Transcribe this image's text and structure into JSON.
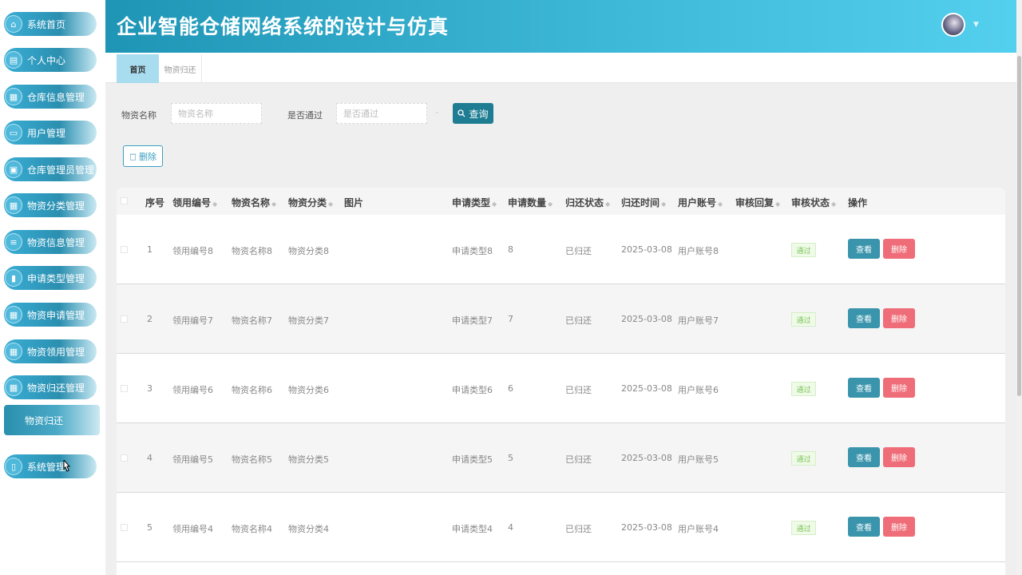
{
  "app": {
    "title": "企业智能仓储网络系统的设计与仿真"
  },
  "sidebar": {
    "items": [
      {
        "label": "系统首页",
        "icon": "home-icon"
      },
      {
        "label": "个人中心",
        "icon": "id-card-icon"
      },
      {
        "label": "仓库信息管理",
        "icon": "chart-icon"
      },
      {
        "label": "用户管理",
        "icon": "monitor-icon"
      },
      {
        "label": "仓库管理员管理",
        "icon": "briefcase-icon"
      },
      {
        "label": "物资分类管理",
        "icon": "grid-icon"
      },
      {
        "label": "物资信息管理",
        "icon": "sliders-icon"
      },
      {
        "label": "申请类型管理",
        "icon": "bar-chart-icon"
      },
      {
        "label": "物资申请管理",
        "icon": "grid-icon"
      },
      {
        "label": "物资领用管理",
        "icon": "grid-icon"
      },
      {
        "label": "物资归还管理",
        "icon": "grid-icon"
      },
      {
        "label": "系统管理",
        "icon": "book-icon"
      }
    ],
    "sub_item": "物资归还"
  },
  "tabs": [
    {
      "label": "首页",
      "active": true
    },
    {
      "label": "物资归还",
      "active": false
    }
  ],
  "search": {
    "name_label": "物资名称",
    "name_placeholder": "物资名称",
    "pass_label": "是否通过",
    "pass_placeholder": "是否通过",
    "search_button": "查询",
    "delete_button": "删除"
  },
  "table": {
    "headers": [
      "序号",
      "领用编号",
      "物资名称",
      "物资分类",
      "图片",
      "申请类型",
      "申请数量",
      "归还状态",
      "归还时间",
      "用户账号",
      "审核回复",
      "审核状态",
      "操作"
    ],
    "rows": [
      {
        "idx": "1",
        "code": "领用编号8",
        "name": "物资名称8",
        "cat": "物资分类8",
        "type": "申请类型8",
        "qty": "8",
        "status": "已归还",
        "time": "2025-03-08",
        "user": "用户账号8",
        "audit": "通过"
      },
      {
        "idx": "2",
        "code": "领用编号7",
        "name": "物资名称7",
        "cat": "物资分类7",
        "type": "申请类型7",
        "qty": "7",
        "status": "已归还",
        "time": "2025-03-08",
        "user": "用户账号7",
        "audit": "通过"
      },
      {
        "idx": "3",
        "code": "领用编号6",
        "name": "物资名称6",
        "cat": "物资分类6",
        "type": "申请类型6",
        "qty": "6",
        "status": "已归还",
        "time": "2025-03-08",
        "user": "用户账号6",
        "audit": "通过"
      },
      {
        "idx": "4",
        "code": "领用编号5",
        "name": "物资名称5",
        "cat": "物资分类5",
        "type": "申请类型5",
        "qty": "5",
        "status": "已归还",
        "time": "2025-03-08",
        "user": "用户账号5",
        "audit": "通过"
      },
      {
        "idx": "5",
        "code": "领用编号4",
        "name": "物资名称4",
        "cat": "物资分类4",
        "type": "申请类型4",
        "qty": "4",
        "status": "已归还",
        "time": "2025-03-08",
        "user": "用户账号4",
        "audit": "通过"
      }
    ],
    "view_label": "查看",
    "delete_label": "删除"
  },
  "colors": {
    "header_start": "#1f95b6",
    "header_end": "#53d0ee",
    "accent": "#1e7d92",
    "danger": "#ee6d78",
    "success": "#7cc35a"
  }
}
